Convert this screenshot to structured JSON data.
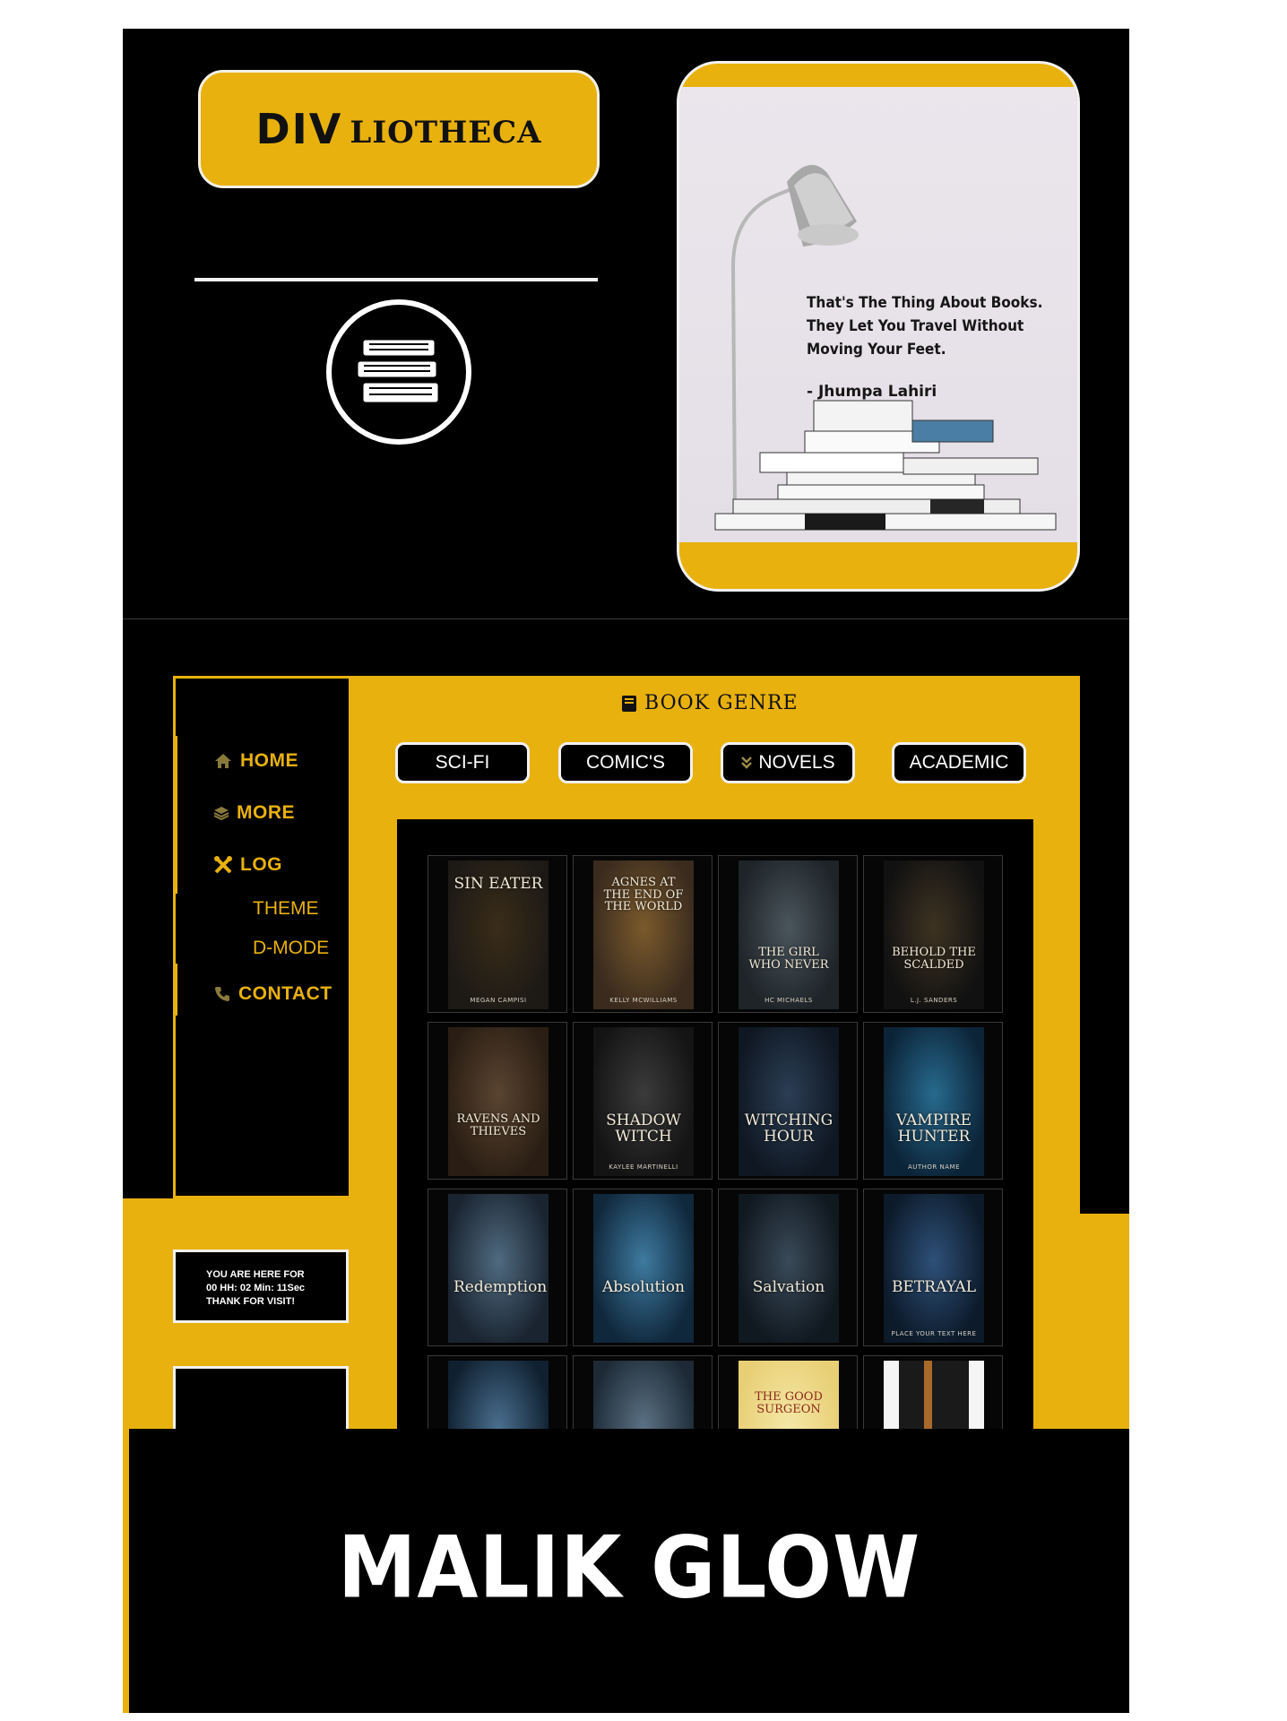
{
  "brand": {
    "logo_bold": "DIV",
    "logo_rest": "LIOTHECA",
    "accent_color": "#e8b10e"
  },
  "hero": {
    "quote_lines": [
      "That's The Thing About Books.",
      "They Let You Travel Without",
      "Moving Your Feet."
    ],
    "quote_author": "- Jhumpa Lahiri"
  },
  "sidebar": {
    "items": [
      {
        "label": "HOME",
        "icon": "home-icon"
      },
      {
        "label": "MORE",
        "icon": "layers-icon"
      },
      {
        "label": "LOG",
        "icon": "tools-icon"
      },
      {
        "label": "CONTACT",
        "icon": "phone-icon"
      }
    ],
    "sub_items": [
      "THEME",
      "D-MODE"
    ]
  },
  "timer": {
    "line1": "YOU ARE HERE FOR",
    "line2": "00 HH: 02 Min: 11Sec",
    "line3": "THANK FOR VISIT!"
  },
  "genre": {
    "title": "BOOK GENRE",
    "buttons": [
      "SCI-FI",
      "COMIC'S",
      "NOVELS",
      "ACADEMIC"
    ]
  },
  "books": [
    {
      "title": "SIN EATER",
      "author": "MEGAN CAMPISI"
    },
    {
      "title": "AGNES AT THE END OF THE WORLD",
      "author": "KELLY MCWILLIAMS"
    },
    {
      "title": "THE GIRL WHO NEVER",
      "author": "HC MICHAELS"
    },
    {
      "title": "BEHOLD THE SCALDED",
      "author": "L.J. SANDERS"
    },
    {
      "title": "RAVENS AND THIEVES",
      "author": ""
    },
    {
      "title": "SHADOW WITCH",
      "author": "KAYLEE MARTINELLI"
    },
    {
      "title": "WITCHING HOUR",
      "author": ""
    },
    {
      "title": "VAMPIRE HUNTER",
      "author": "AUTHOR NAME"
    },
    {
      "title": "Redemption",
      "author": ""
    },
    {
      "title": "Absolution",
      "author": ""
    },
    {
      "title": "Salvation",
      "author": ""
    },
    {
      "title": "BETRAYAL",
      "author": "PLACE YOUR TEXT HERE"
    },
    {
      "title": "",
      "author": ""
    },
    {
      "title": "",
      "author": ""
    },
    {
      "title": "THE GOOD SURGEON",
      "author": ""
    },
    {
      "title": "",
      "author": ""
    }
  ],
  "footer": {
    "text": "MALIK GLOW"
  }
}
